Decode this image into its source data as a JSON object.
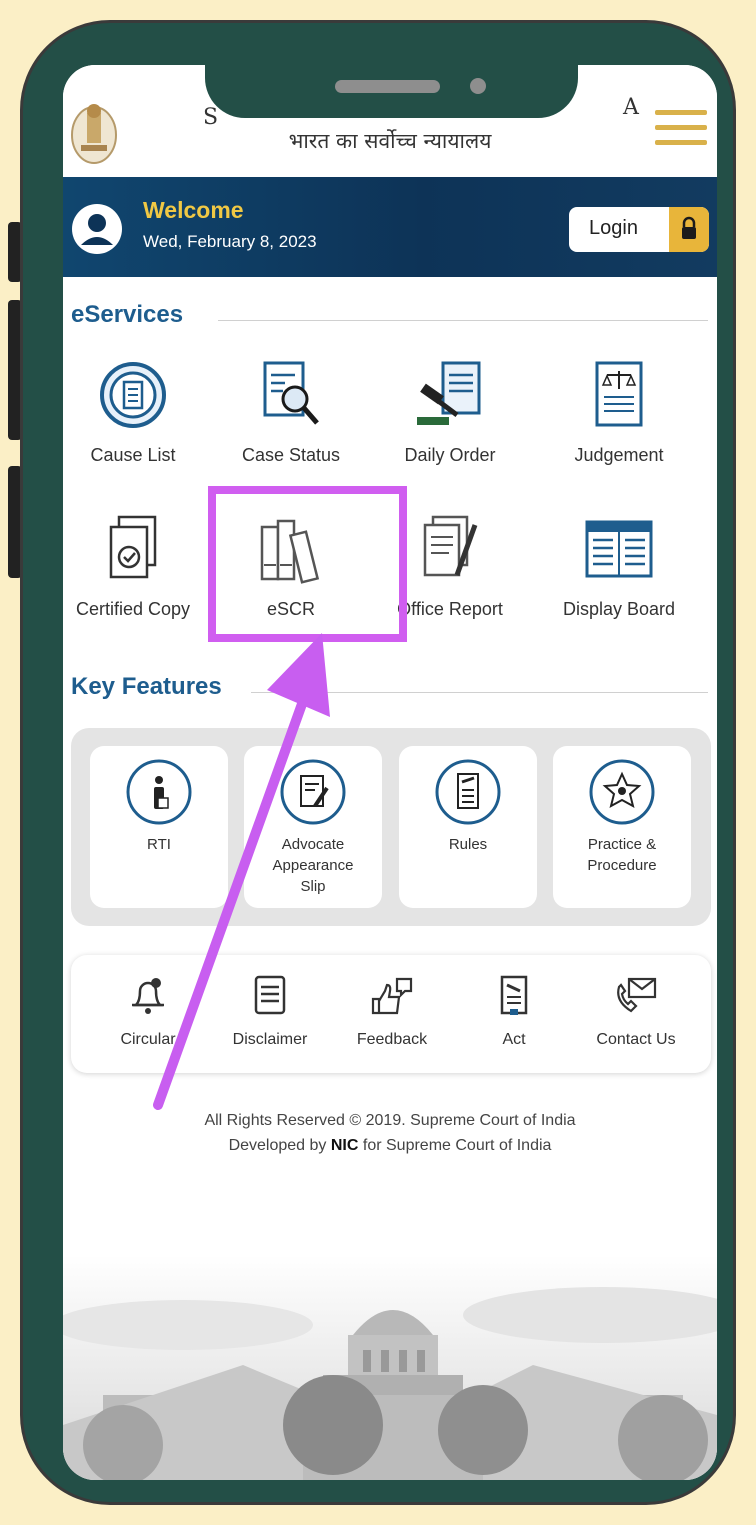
{
  "header": {
    "title_left_fragment": "S",
    "title_right_fragment": "A",
    "hindi_title": "भारत का सर्वोच्च न्यायालय"
  },
  "welcome": {
    "title": "Welcome",
    "date": "Wed, February 8, 2023",
    "login_label": "Login"
  },
  "eservices": {
    "title": "eServices",
    "items": [
      {
        "label": "Cause List",
        "icon": "cause-list-icon"
      },
      {
        "label": "Case Status",
        "icon": "case-status-icon"
      },
      {
        "label": "Daily Order",
        "icon": "daily-order-icon"
      },
      {
        "label": "Judgement",
        "icon": "judgement-icon"
      },
      {
        "label": "Certified Copy",
        "icon": "certified-copy-icon"
      },
      {
        "label": "eSCR",
        "icon": "books-icon"
      },
      {
        "label": "Office Report",
        "icon": "office-report-icon"
      },
      {
        "label": "Display Board",
        "icon": "display-board-icon"
      }
    ]
  },
  "key_features": {
    "title": "Key Features",
    "cards": [
      {
        "label": "RTI",
        "icon": "info-person-icon"
      },
      {
        "label": "Advocate Appearance Slip",
        "icon": "document-edit-icon"
      },
      {
        "label": "Rules",
        "icon": "rules-document-icon"
      },
      {
        "label": "Practice & Procedure",
        "icon": "emblem-star-icon"
      }
    ]
  },
  "bottom_links": [
    {
      "label": "Circular",
      "icon": "bell-icon"
    },
    {
      "label": "Disclaimer",
      "icon": "list-document-icon"
    },
    {
      "label": "Feedback",
      "icon": "thumbs-icon"
    },
    {
      "label": "Act",
      "icon": "act-document-icon"
    },
    {
      "label": "Contact Us",
      "icon": "phone-mail-icon"
    }
  ],
  "footer": {
    "line1": "All Rights Reserved © 2019. Supreme Court of India",
    "line2_prefix": "Developed by ",
    "line2_bold": "NIC",
    "line2_suffix": " for Supreme Court of India"
  },
  "annotation": {
    "highlight_color": "#d05ef0"
  },
  "colors": {
    "background": "#fbefc6",
    "phone_frame": "#234f47",
    "welcome_banner": "#0d3357",
    "welcome_title": "#f0c844",
    "accent_gold": "#e8b53a",
    "section_title": "#1e5d8e"
  }
}
